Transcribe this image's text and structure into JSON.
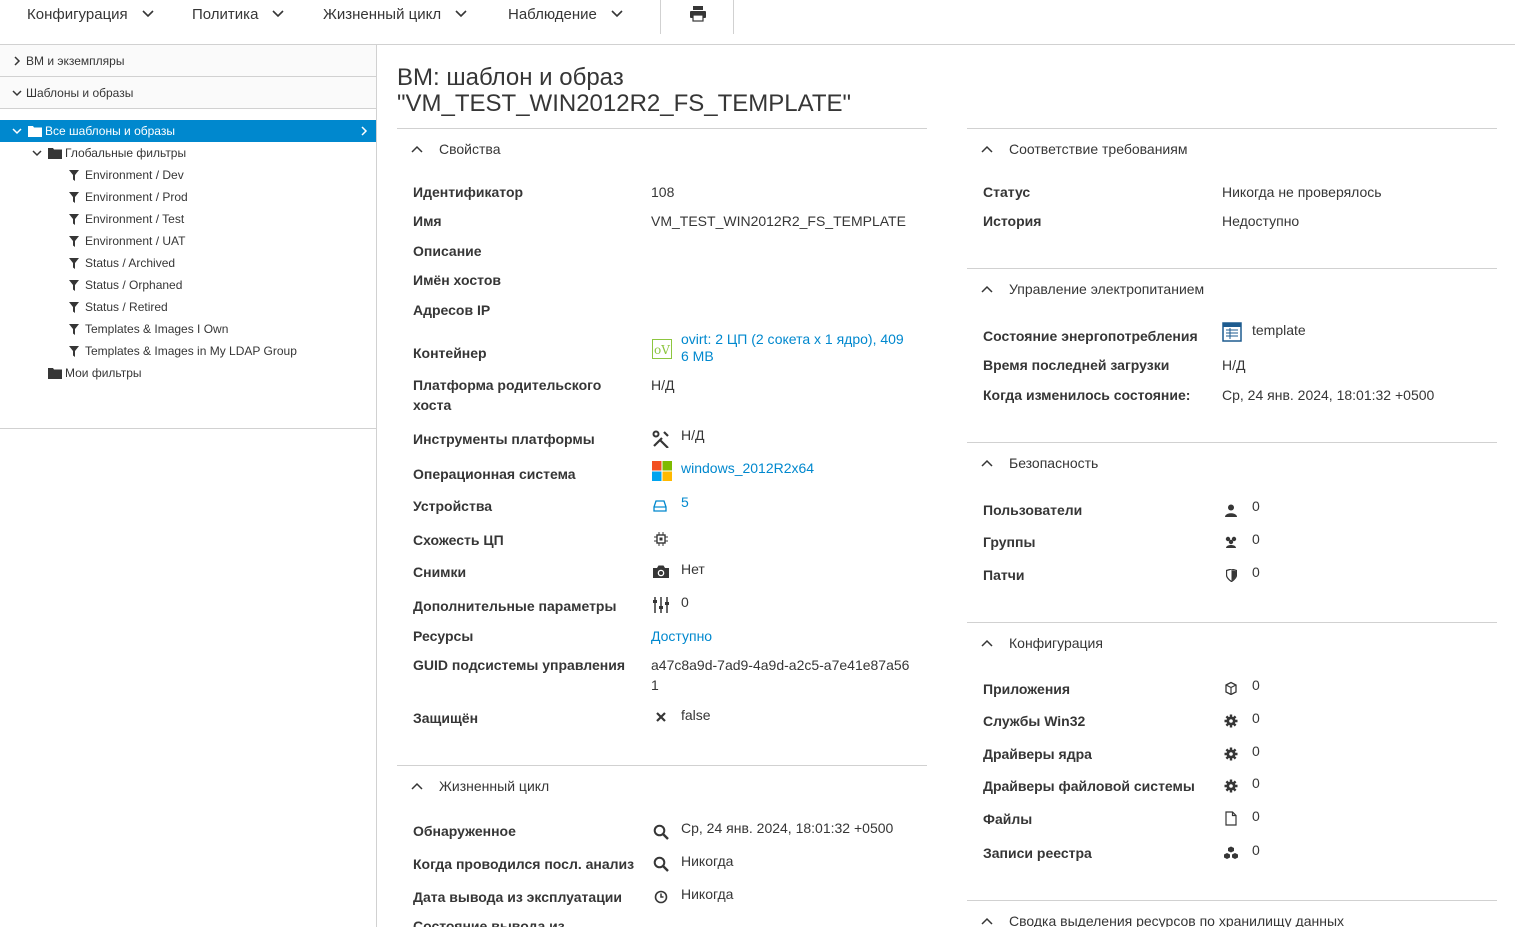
{
  "toolbar": {
    "menus": [
      "Конфигурация",
      "Политика",
      "Жизненный цикл",
      "Наблюдение"
    ]
  },
  "sidebar": {
    "accordions": [
      "ВМ и экземпляры",
      "Шаблоны и образы"
    ],
    "tree": {
      "root": "Все шаблоны и образы",
      "global_filters": "Глобальные фильтры",
      "filters": [
        "Environment / Dev",
        "Environment / Prod",
        "Environment / Test",
        "Environment / UAT",
        "Status / Archived",
        "Status / Orphaned",
        "Status / Retired",
        "Templates & Images I Own",
        "Templates & Images in My LDAP Group"
      ],
      "my_filters": "Мои фильтры"
    }
  },
  "page": {
    "title_line1": "ВМ: шаблон и образ",
    "title_line2": "\"VM_TEST_WIN2012R2_FS_TEMPLATE\""
  },
  "properties": {
    "title": "Свойства",
    "rows": [
      {
        "label": "Идентификатор",
        "value": "108"
      },
      {
        "label": "Имя",
        "value": "VM_TEST_WIN2012R2_FS_TEMPLATE"
      },
      {
        "label": "Описание",
        "value": ""
      },
      {
        "label": "Имён хостов",
        "value": ""
      },
      {
        "label": "Адресов IP",
        "value": ""
      },
      {
        "label": "Контейнер",
        "value_line1": "ovirt: 2 ЦП (2 сокета x 1 ядро), 409",
        "value_line2": "6 MB",
        "icon": "ovirt-icon"
      },
      {
        "label_line1": "Платформа родительского",
        "label_line2": "хоста",
        "value": "Н/Д"
      },
      {
        "label": "Инструменты платформы",
        "value": "Н/Д",
        "icon": "tools-icon"
      },
      {
        "label": "Операционная система",
        "value": "windows_2012R2x64",
        "icon": "windows-icon"
      },
      {
        "label": "Устройства",
        "value": "5",
        "icon": "drive-icon"
      },
      {
        "label": "Схожесть ЦП",
        "value": "",
        "icon": "cpu-icon"
      },
      {
        "label": "Снимки",
        "value": "Нет",
        "icon": "camera-icon"
      },
      {
        "label": "Дополнительные параметры",
        "value": "0",
        "icon": "sliders-icon"
      },
      {
        "label": "Ресурсы",
        "value": "Доступно"
      },
      {
        "label": "GUID подсистемы управления",
        "value_line1": "a47c8a9d-7ad9-4a9d-a2c5-a7e41e87a56",
        "value_line2": "1"
      },
      {
        "label": "Защищён",
        "value": "false",
        "icon": "close-icon"
      }
    ]
  },
  "lifecycle": {
    "title": "Жизненный цикл",
    "rows": [
      {
        "label": "Обнаруженное",
        "value": "Ср, 24 янв. 2024, 18:01:32 +0500",
        "icon": "search-icon"
      },
      {
        "label": "Когда проводился посл. анализ",
        "value": "Никогда",
        "icon": "search-icon"
      },
      {
        "label": "Дата вывода из эксплуатации",
        "value": "Никогда",
        "icon": "clock-icon"
      },
      {
        "label": "Состояние вывода из",
        "value": ""
      }
    ]
  },
  "compliance": {
    "title": "Соответствие требованиям",
    "rows": [
      {
        "label": "Статус",
        "value": "Никогда не проверялось"
      },
      {
        "label": "История",
        "value": "Недоступно"
      }
    ]
  },
  "power": {
    "title": "Управление электропитанием",
    "rows": [
      {
        "label": "Состояние энергопотребления",
        "value": "template",
        "icon": "template-icon"
      },
      {
        "label": "Время последней загрузки",
        "value": "Н/Д"
      },
      {
        "label": "Когда изменилось состояние:",
        "value": "Ср, 24 янв. 2024, 18:01:32 +0500"
      }
    ]
  },
  "security": {
    "title": "Безопасность",
    "rows": [
      {
        "label": "Пользователи",
        "value": "0",
        "icon": "user-icon"
      },
      {
        "label": "Группы",
        "value": "0",
        "icon": "group-icon"
      },
      {
        "label": "Патчи",
        "value": "0",
        "icon": "shield-icon"
      }
    ]
  },
  "configuration": {
    "title": "Конфигурация",
    "rows": [
      {
        "label": "Приложения",
        "value": "0",
        "icon": "package-icon"
      },
      {
        "label": "Службы Win32",
        "value": "0",
        "icon": "gear-icon"
      },
      {
        "label": "Драйверы ядра",
        "value": "0",
        "icon": "gear-icon"
      },
      {
        "label": "Драйверы файловой системы",
        "value": "0",
        "icon": "gear-icon"
      },
      {
        "label": "Файлы",
        "value": "0",
        "icon": "file-icon"
      },
      {
        "label": "Записи реестра",
        "value": "0",
        "icon": "registry-icon"
      }
    ]
  },
  "storage": {
    "title": "Сводка выделения ресурсов по хранилищу данных"
  },
  "colors": {
    "accent": "#0088ce",
    "text": "#363636",
    "border": "#d1d1d1"
  }
}
